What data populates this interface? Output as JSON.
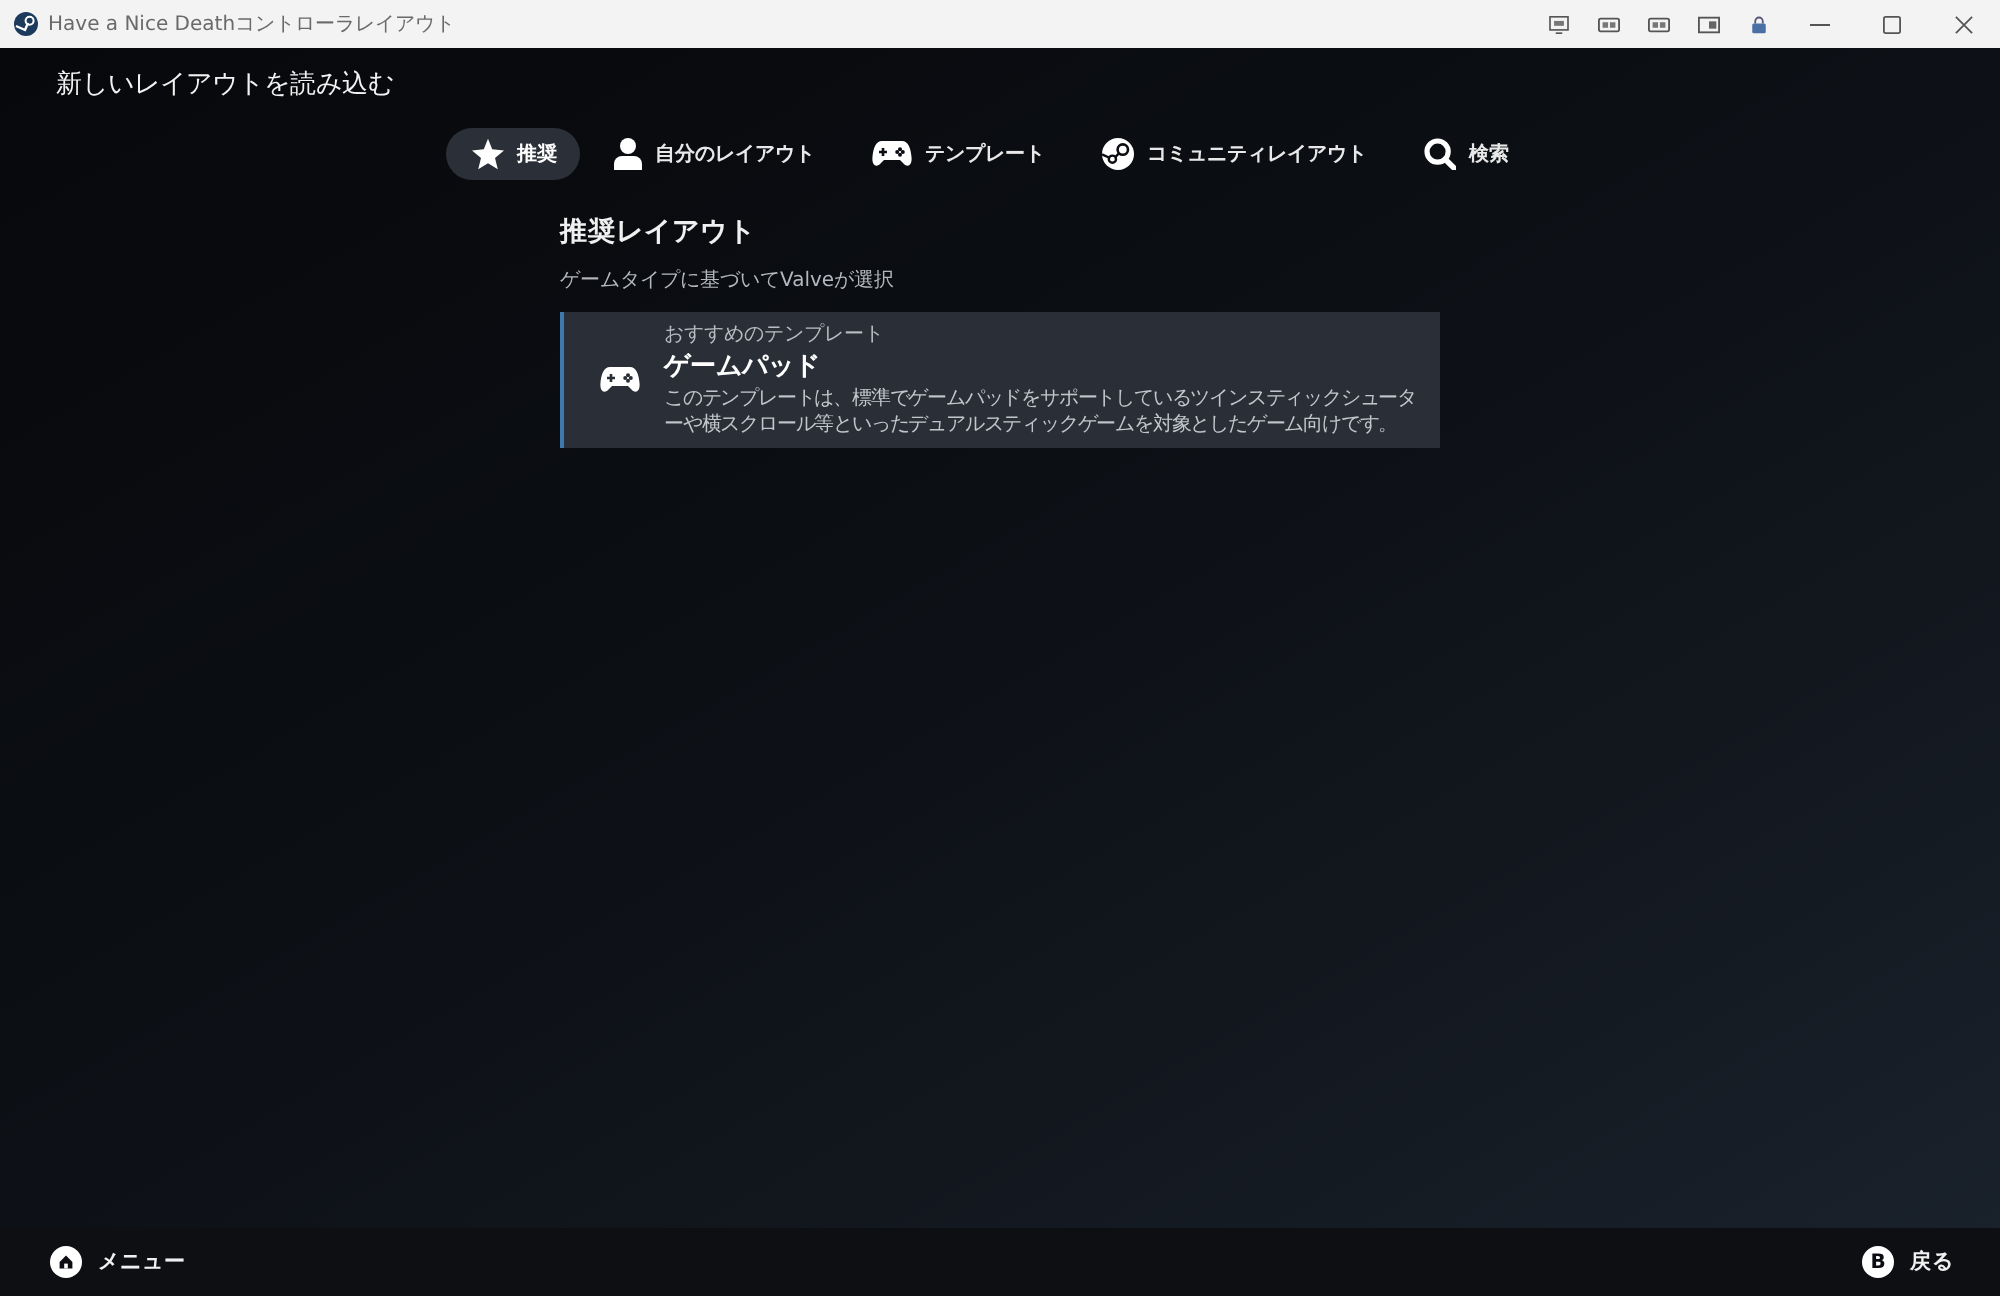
{
  "window": {
    "title": "Have a Nice Deathコントローラレイアウト"
  },
  "header": {
    "title": "新しいレイアウトを読み込む"
  },
  "tabs": [
    {
      "kind": "star",
      "label": "推奨",
      "selected": true
    },
    {
      "kind": "person",
      "label": "自分のレイアウト",
      "selected": false
    },
    {
      "kind": "gamepad",
      "label": "テンプレート",
      "selected": false
    },
    {
      "kind": "community",
      "label": "コミュニティレイアウト",
      "selected": false
    },
    {
      "kind": "search",
      "label": "検索",
      "selected": false
    }
  ],
  "section": {
    "title": "推奨レイアウト",
    "subtitle": "ゲームタイプに基づいてValveが選択"
  },
  "layouts": [
    {
      "kind": "gamepad",
      "caption": "おすすめのテンプレート",
      "name": "ゲームパッド",
      "description": "このテンプレートは、標準でゲームパッドをサポートしているツインスティックシューターや横スクロール等といったデュアルスティックゲームを対象としたゲーム向けです。",
      "selected": true
    }
  ],
  "footer": [
    {
      "kind": "home",
      "label": "メニュー"
    },
    {
      "kind": "key",
      "key": "B",
      "label": "戻る"
    }
  ]
}
